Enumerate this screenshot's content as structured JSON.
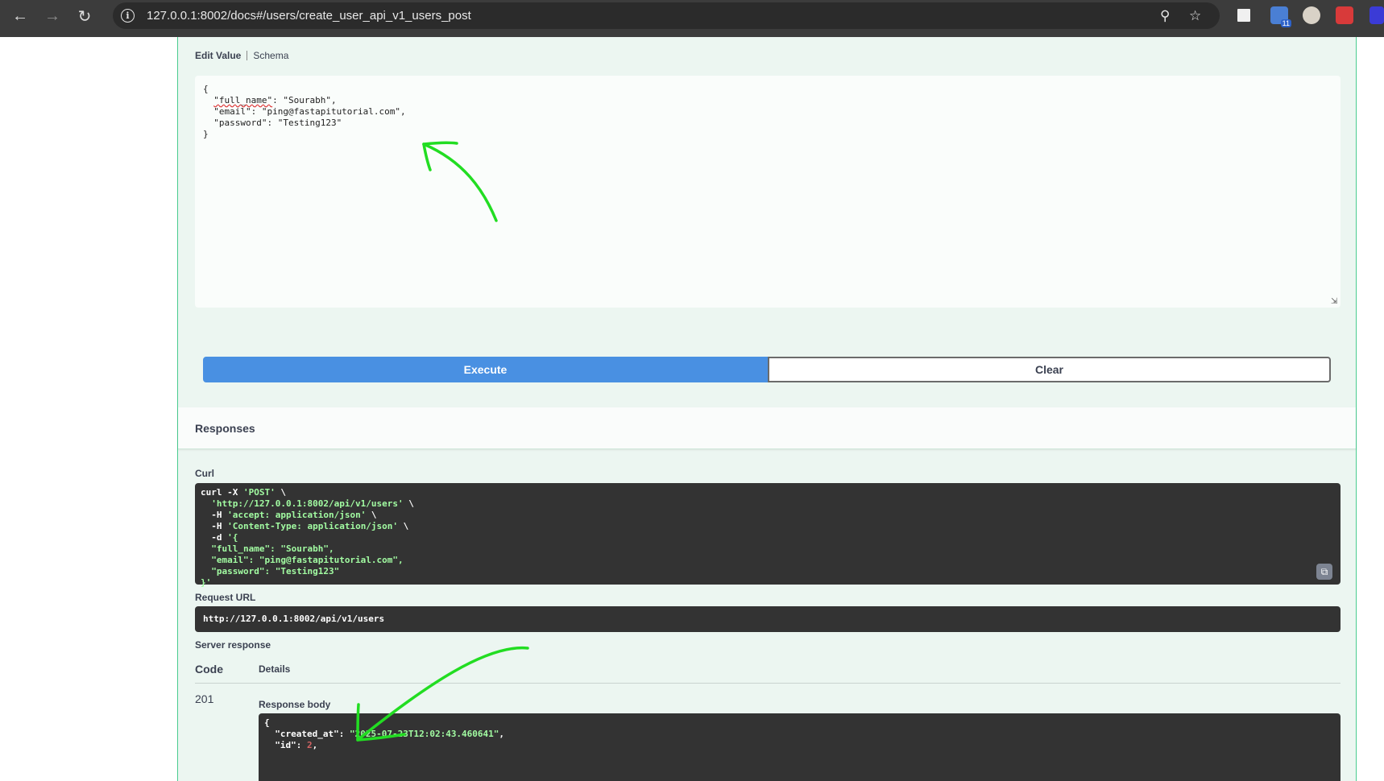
{
  "browser": {
    "url": "127.0.0.1:8002/docs#/users/create_user_api_v1_users_post",
    "extension_badge": "11"
  },
  "request_body": {
    "tab_edit": "Edit Value",
    "tab_schema": "Schema",
    "line1": "{",
    "line2_key": "\"full_name\"",
    "line2_rest": ": \"Sourabh\",",
    "line3": "  \"email\": \"ping@fastapitutorial.com\",",
    "line4": "  \"password\": \"Testing123\"",
    "line5": "}"
  },
  "buttons": {
    "execute": "Execute",
    "clear": "Clear"
  },
  "responses": {
    "title": "Responses",
    "curl_label": "Curl",
    "curl_line1": "curl -X ",
    "curl_method": "'POST'",
    "curl_line1_end": " \\",
    "curl_url": "'http://127.0.0.1:8002/api/v1/users'",
    "curl_h1": "'accept: application/json'",
    "curl_h2": "'Content-Type: application/json'",
    "curl_d": "'{",
    "curl_b1": "\"full_name\": \"Sourabh\",",
    "curl_b2": "\"email\": \"ping@fastapitutorial.com\",",
    "curl_b3": "\"password\": \"Testing123\"",
    "curl_end": "}'",
    "request_url_label": "Request URL",
    "request_url": "http://127.0.0.1:8002/api/v1/users",
    "server_response_label": "Server response",
    "col_code": "Code",
    "col_details": "Details",
    "status_code": "201",
    "response_body_label": "Response body",
    "rb_open": "{",
    "rb_created_key": "\"created_at\"",
    "rb_created_val": "\"2025-07-23T12:02:43.460641\"",
    "rb_id_key": "\"id\"",
    "rb_id_val": "2"
  },
  "colors": {
    "execute_blue": "#4990e2",
    "post_green": "#49cc90",
    "annotation_green": "#22dd22"
  }
}
